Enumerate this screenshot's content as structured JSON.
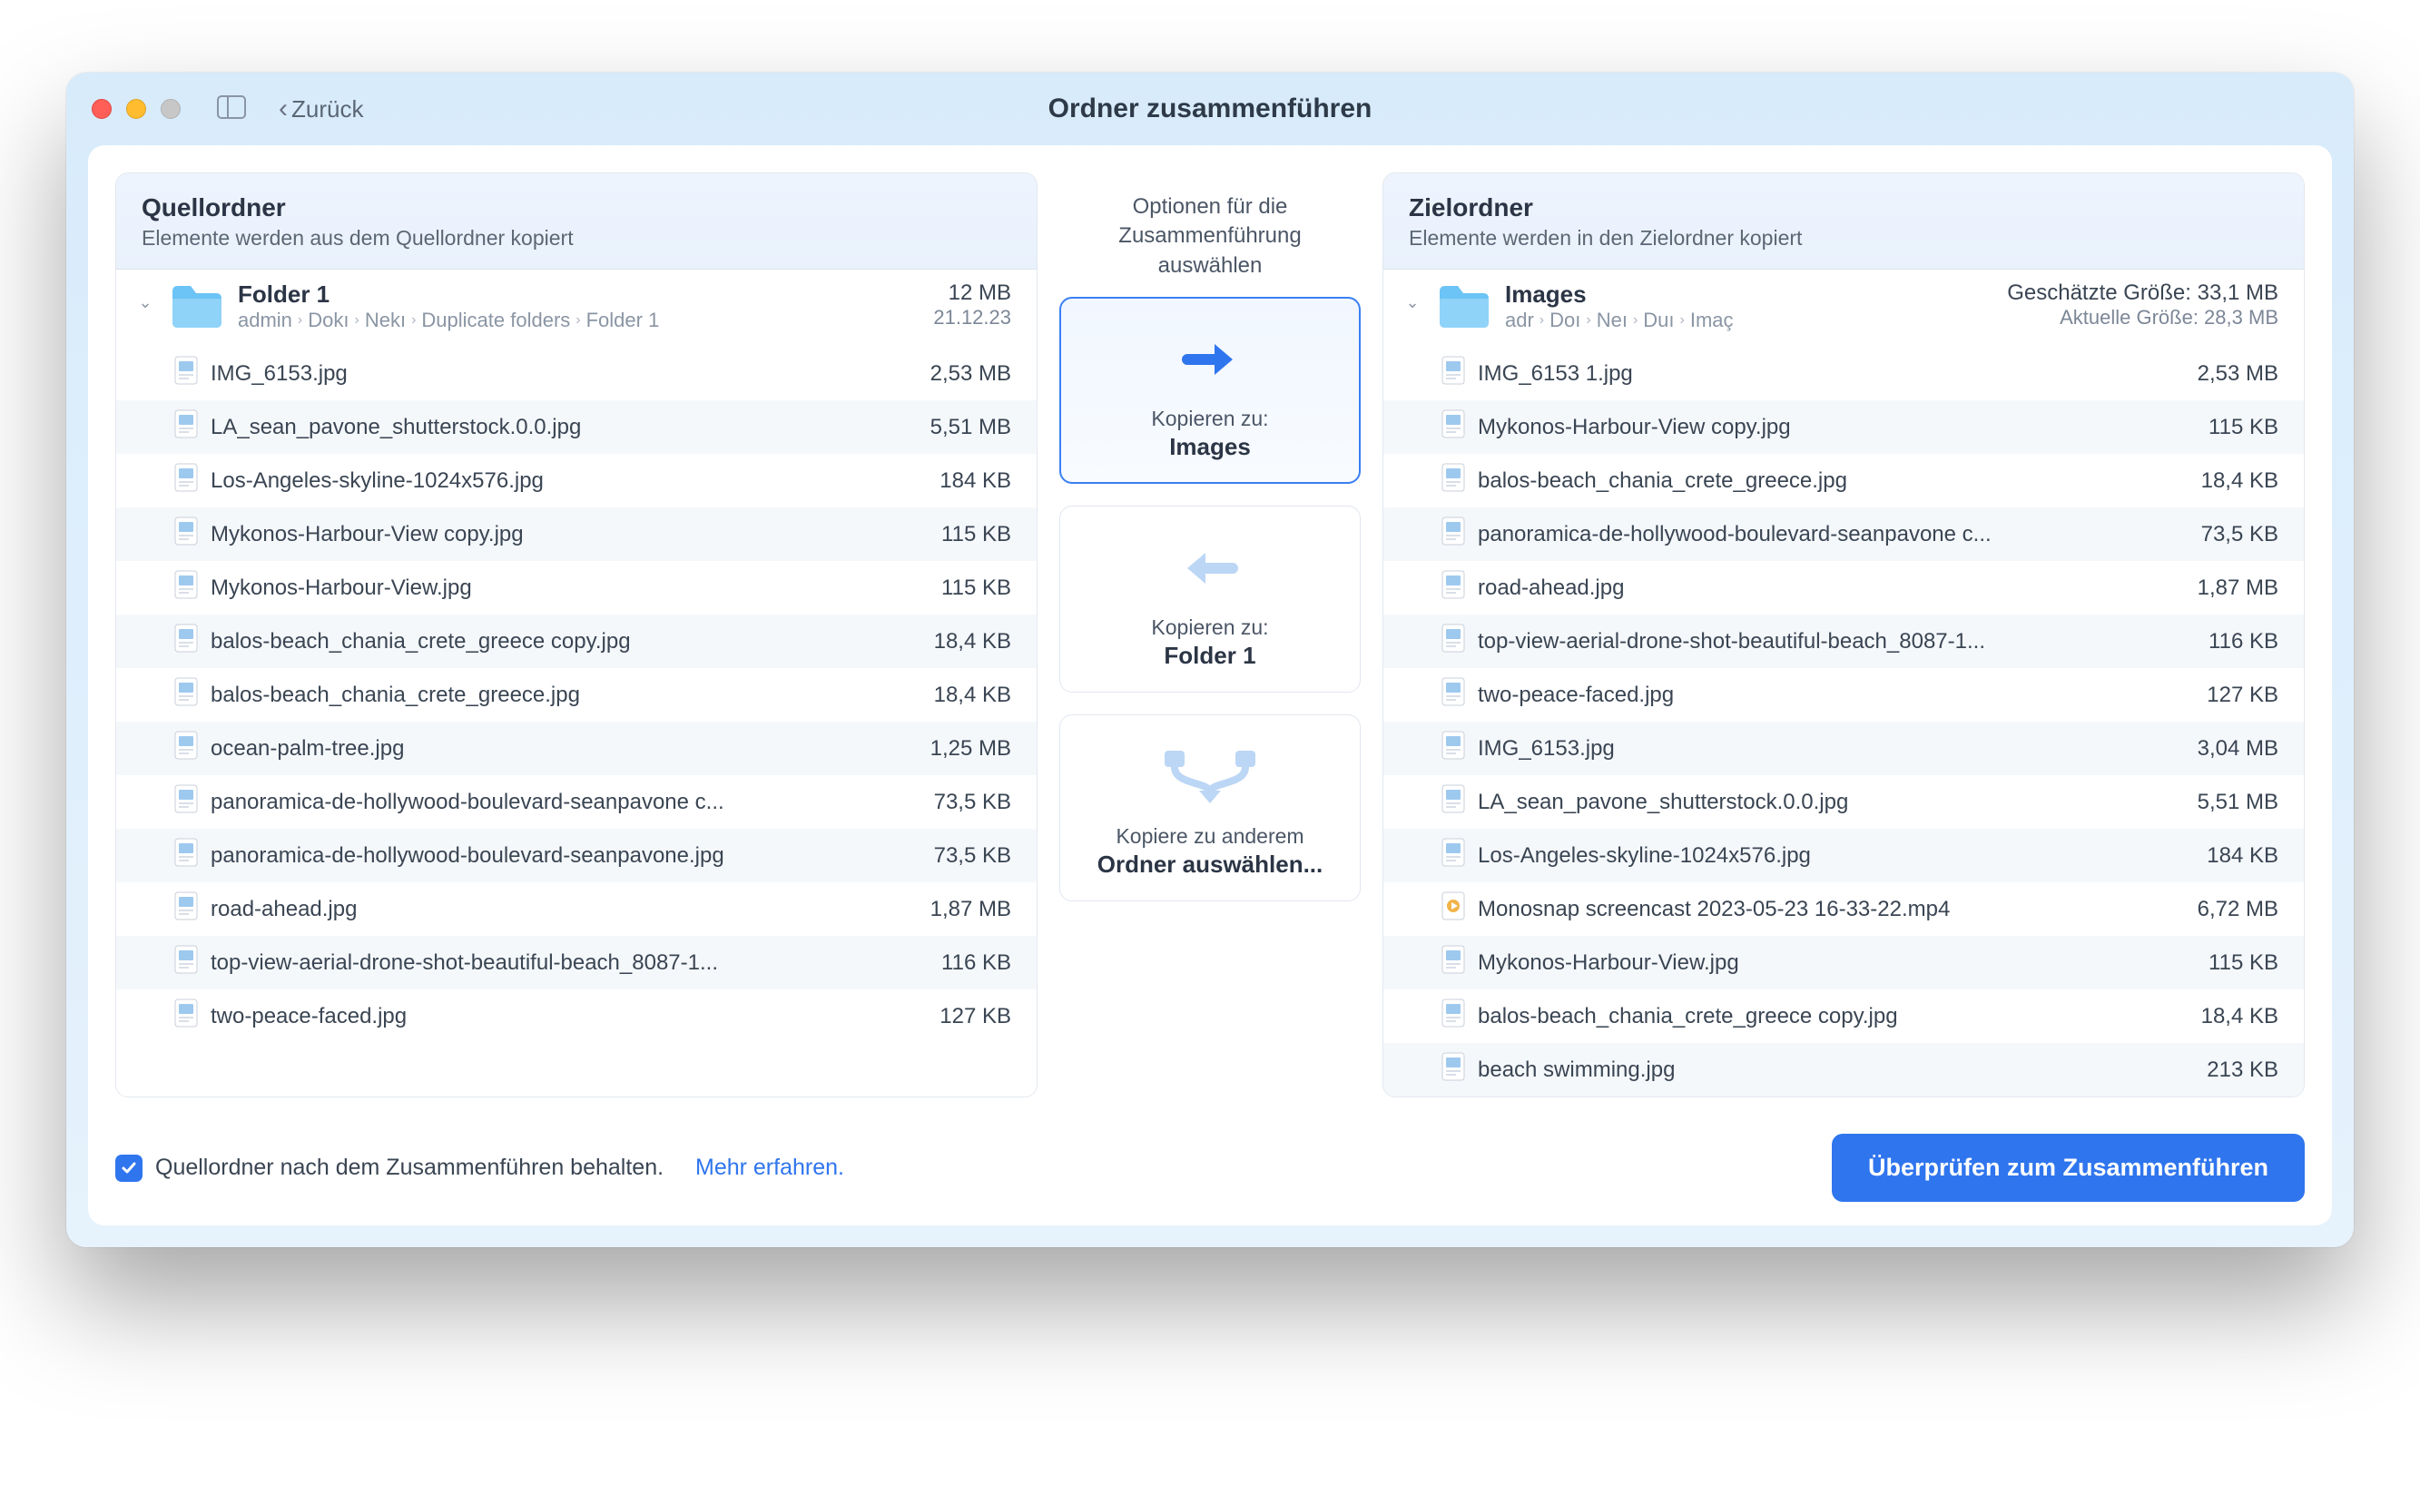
{
  "window": {
    "title": "Ordner zusammenführen",
    "back_label": "Zurück"
  },
  "source": {
    "panel_title": "Quellordner",
    "panel_subtitle": "Elemente werden aus dem Quellordner kopiert",
    "folder_name": "Folder 1",
    "breadcrumbs": [
      "admin",
      "Dokı",
      "Nekı",
      "Duplicate folders",
      "Folder 1"
    ],
    "stat_primary": "12 MB",
    "stat_secondary": "21.12.23",
    "files": [
      {
        "name": "IMG_6153.jpg",
        "size": "2,53 MB",
        "type": "image"
      },
      {
        "name": "LA_sean_pavone_shutterstock.0.0.jpg",
        "size": "5,51 MB",
        "type": "image"
      },
      {
        "name": "Los-Angeles-skyline-1024x576.jpg",
        "size": "184 KB",
        "type": "image"
      },
      {
        "name": "Mykonos-Harbour-View copy.jpg",
        "size": "115 KB",
        "type": "image"
      },
      {
        "name": "Mykonos-Harbour-View.jpg",
        "size": "115 KB",
        "type": "image"
      },
      {
        "name": "balos-beach_chania_crete_greece copy.jpg",
        "size": "18,4 KB",
        "type": "image"
      },
      {
        "name": "balos-beach_chania_crete_greece.jpg",
        "size": "18,4 KB",
        "type": "image"
      },
      {
        "name": "ocean-palm-tree.jpg",
        "size": "1,25 MB",
        "type": "image"
      },
      {
        "name": "panoramica-de-hollywood-boulevard-seanpavone c...",
        "size": "73,5 KB",
        "type": "image"
      },
      {
        "name": "panoramica-de-hollywood-boulevard-seanpavone.jpg",
        "size": "73,5 KB",
        "type": "image"
      },
      {
        "name": "road-ahead.jpg",
        "size": "1,87 MB",
        "type": "image"
      },
      {
        "name": "top-view-aerial-drone-shot-beautiful-beach_8087-1...",
        "size": "116 KB",
        "type": "image"
      },
      {
        "name": "two-peace-faced.jpg",
        "size": "127 KB",
        "type": "image"
      }
    ]
  },
  "middle": {
    "caption_line1": "Optionen für die Zusammenführung",
    "caption_line2": "auswählen",
    "options": [
      {
        "caption": "Kopieren zu:",
        "target": "Images",
        "selected": true,
        "icon": "arrow-right"
      },
      {
        "caption": "Kopieren zu:",
        "target": "Folder 1",
        "selected": false,
        "icon": "arrow-left"
      },
      {
        "caption": "Kopiere zu anderem",
        "target": "Ordner auswählen...",
        "selected": false,
        "icon": "merge"
      }
    ]
  },
  "target": {
    "panel_title": "Zielordner",
    "panel_subtitle": "Elemente werden in den Zielordner kopiert",
    "folder_name": "Images",
    "breadcrumbs": [
      "adr",
      "Doı",
      "Neı",
      "Duı",
      "Imaç"
    ],
    "stat_primary": "Geschätzte Größe: 33,1 MB",
    "stat_secondary": "Aktuelle Größe: 28,3 MB",
    "files": [
      {
        "name": "IMG_6153 1.jpg",
        "size": "2,53 MB",
        "type": "image"
      },
      {
        "name": "Mykonos-Harbour-View copy.jpg",
        "size": "115 KB",
        "type": "image"
      },
      {
        "name": "balos-beach_chania_crete_greece.jpg",
        "size": "18,4 KB",
        "type": "image"
      },
      {
        "name": "panoramica-de-hollywood-boulevard-seanpavone c...",
        "size": "73,5 KB",
        "type": "image"
      },
      {
        "name": "road-ahead.jpg",
        "size": "1,87 MB",
        "type": "image"
      },
      {
        "name": "top-view-aerial-drone-shot-beautiful-beach_8087-1...",
        "size": "116 KB",
        "type": "image"
      },
      {
        "name": "two-peace-faced.jpg",
        "size": "127 KB",
        "type": "image"
      },
      {
        "name": "IMG_6153.jpg",
        "size": "3,04 MB",
        "type": "image"
      },
      {
        "name": "LA_sean_pavone_shutterstock.0.0.jpg",
        "size": "5,51 MB",
        "type": "image"
      },
      {
        "name": "Los-Angeles-skyline-1024x576.jpg",
        "size": "184 KB",
        "type": "image"
      },
      {
        "name": "Monosnap screencast 2023-05-23 16-33-22.mp4",
        "size": "6,72 MB",
        "type": "video"
      },
      {
        "name": "Mykonos-Harbour-View.jpg",
        "size": "115 KB",
        "type": "image"
      },
      {
        "name": "balos-beach_chania_crete_greece copy.jpg",
        "size": "18,4 KB",
        "type": "image"
      },
      {
        "name": "beach swimming.jpg",
        "size": "213 KB",
        "type": "image"
      }
    ]
  },
  "footer": {
    "checkbox_checked": true,
    "checkbox_label": "Quellordner nach dem Zusammenführen behalten.",
    "link_label": "Mehr erfahren.",
    "cta_label": "Überprüfen zum Zusammenführen"
  }
}
